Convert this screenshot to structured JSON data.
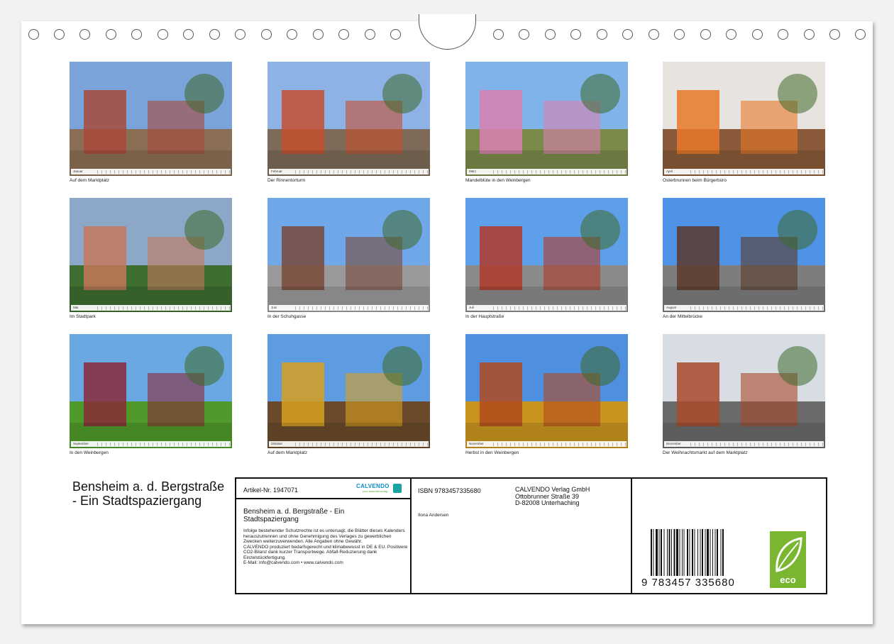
{
  "photos": [
    {
      "month": "Januar",
      "caption": "Auf dem Marktplatz",
      "sky": "#7aa3d9",
      "ground": "#8a6f55",
      "accent": "#a84a3a"
    },
    {
      "month": "Februar",
      "caption": "Der Rinnentorturm",
      "sky": "#8db2e6",
      "ground": "#7d6a58",
      "accent": "#c6502e"
    },
    {
      "month": "März",
      "caption": "Mandelblüte in den Weinbergen",
      "sky": "#7fb3ea",
      "ground": "#7a8a4a",
      "accent": "#d97fb0"
    },
    {
      "month": "April",
      "caption": "Osterbrunnen beim Bürgerbüro",
      "sky": "#e7e4df",
      "ground": "#8a5a3a",
      "accent": "#e8782a"
    },
    {
      "month": "Mai",
      "caption": "Im Stadtpark",
      "sky": "#8da7c8",
      "ground": "#3e6e30",
      "accent": "#c4785a"
    },
    {
      "month": "Juni",
      "caption": "In der Schuhgasse",
      "sky": "#6fa7e8",
      "ground": "#9a9a9a",
      "accent": "#7a4a3a"
    },
    {
      "month": "Juli",
      "caption": "In  der Hauptstraße",
      "sky": "#5d9fe8",
      "ground": "#8a8a8a",
      "accent": "#b03a2a"
    },
    {
      "month": "August",
      "caption": "An der Mittelbrücke",
      "sky": "#4f93e6",
      "ground": "#7d7d7d",
      "accent": "#5a3a2a"
    },
    {
      "month": "September",
      "caption": "In den Weinbergen",
      "sky": "#69a8e2",
      "ground": "#4f9a2a",
      "accent": "#8a2a3a"
    },
    {
      "month": "Oktober",
      "caption": "Auf dem Marktplatz",
      "sky": "#5d9ce0",
      "ground": "#6a4a2a",
      "accent": "#d8a020"
    },
    {
      "month": "November",
      "caption": "Herbst in den Weinbergen",
      "sky": "#4f8fe0",
      "ground": "#c8941e",
      "accent": "#b24a1e"
    },
    {
      "month": "Dezember",
      "caption": "Der Weihnachtsmarkt auf dem Marktplatz",
      "sky": "#d8dde4",
      "ground": "#6a6a6a",
      "accent": "#a84a2a"
    }
  ],
  "cover_title": "Bensheim a. d. Bergstraße - Ein Stadtspaziergang",
  "info": {
    "article": "Artikel-Nr. 1947071",
    "logo": "CALVENDO",
    "logo_sub": "your kalenderverlag",
    "product_title": "Bensheim a. d. Bergstraße - Ein Stadtspaziergang",
    "legal": "Infolge bestehender Schutzrechte ist es untersagt, die Blätter dieses Kalenders herauszutrennen und ohne Genehmigung des Verlages zu gewerblichen Zwecken weiterzuverwenden. Alle Angaben ohne Gewähr.\nCALVENDO produziert bedarfsgerecht und klimabewusst in DE & EU. Positivere CO2-Bilanz dank kurzer Transportwege. Abfall-Reduzierung dank Einzelstückfertigung.\nE-Mail: info@calvendo.com • www.calvendo.com",
    "isbn": "ISBN 9783457335680",
    "author": "Ilona Andersen",
    "publisher_line1": "CALVENDO Verlag GmbH",
    "publisher_line2": "Ottobrunner Straße 39",
    "publisher_line3": "D-82008 Unterhaching",
    "barcode_number": "9  783457  335680",
    "eco_label": "eco"
  }
}
